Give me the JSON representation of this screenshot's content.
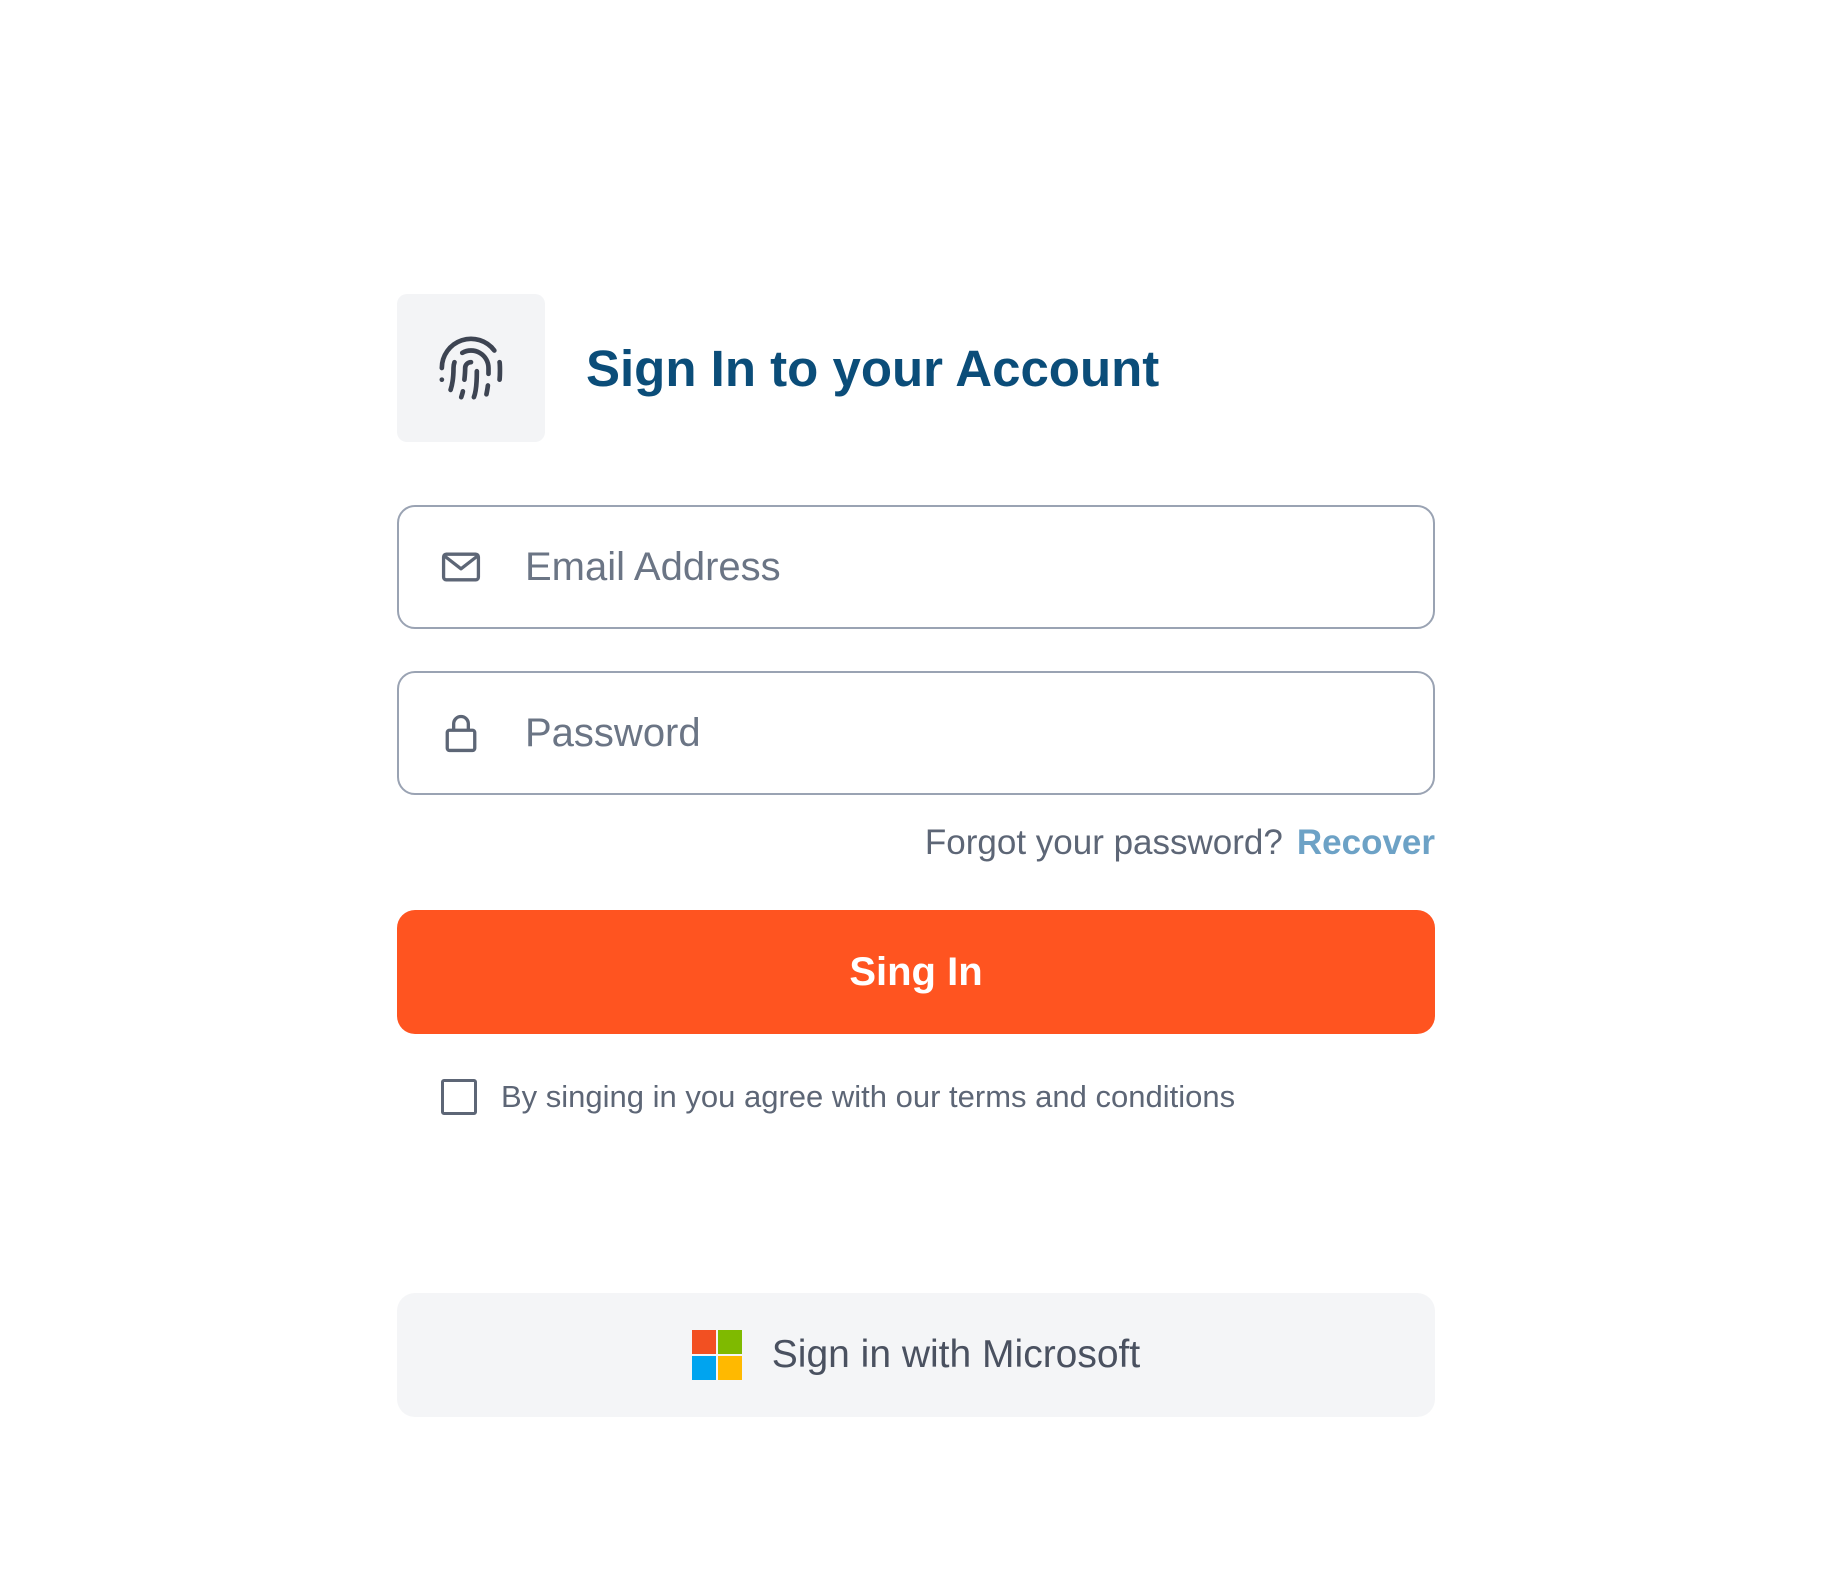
{
  "header": {
    "logo_icon": "fingerprint-icon",
    "title": "Sign In to your Account"
  },
  "form": {
    "email": {
      "icon": "mail-icon",
      "placeholder": "Email Address",
      "value": ""
    },
    "password": {
      "icon": "lock-icon",
      "placeholder": "Password",
      "value": ""
    },
    "forgot_text": "Forgot your password?",
    "recover_link": "Recover",
    "submit_label": "Sing In",
    "terms_label": "By singing in you agree with our terms and conditions",
    "terms_checked": false
  },
  "microsoft": {
    "label": "Sign in with Microsoft",
    "logo_colors": [
      "#f25022",
      "#7fba00",
      "#00a4ef",
      "#ffb900"
    ]
  },
  "colors": {
    "title": "#0b4d79",
    "accent_button": "#ff5420",
    "link": "#6da2c6",
    "field_border": "#9aa3b3",
    "secondary_button_bg": "#f4f5f7"
  }
}
